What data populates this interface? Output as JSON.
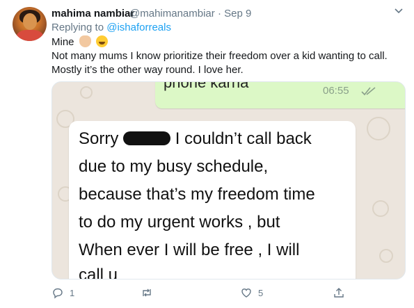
{
  "tweet": {
    "author_name": "mahima nambiar",
    "author_handle": "@mahimanambiar",
    "separator": "·",
    "date": "Sep 9",
    "replying_prefix": "Replying to",
    "replying_to": "@ishaforreals",
    "line1": "Mine",
    "line2": "Not many mums I know prioritize their freedom over a kid wanting to call.",
    "line3": "Mostly it’s the other way round. I love her."
  },
  "chat_image": {
    "green_bubble_text": "phone karna",
    "green_bubble_time": "06:55",
    "white_bubble_lines": [
      "I couldn’t call back",
      "due to my busy schedule,",
      "because that’s my freedom time",
      "to do my urgent works , but",
      "When ever I will be free , I will",
      "call u"
    ],
    "white_bubble_prefix": "Sorry"
  },
  "actions": {
    "reply_count": "1",
    "retweet_count": "",
    "like_count": "5",
    "icons": [
      "reply-icon",
      "retweet-icon",
      "heart-icon",
      "share-icon"
    ]
  }
}
